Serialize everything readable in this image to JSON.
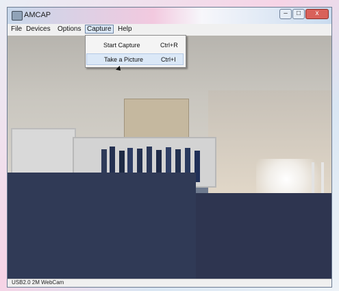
{
  "window": {
    "title": "AMCAP"
  },
  "menubar": {
    "items": [
      {
        "label": "File"
      },
      {
        "label": "Devices"
      },
      {
        "label": "Options"
      },
      {
        "label": "Capture"
      },
      {
        "label": "Help"
      }
    ],
    "active": "Capture"
  },
  "capture_menu": {
    "items": [
      {
        "label": "Start Capture",
        "shortcut": "Ctrl+R"
      },
      {
        "label": "Take a Picture",
        "shortcut": "Ctrl+I",
        "highlighted": true
      }
    ]
  },
  "statusbar": {
    "text": "USB2.0 2M WebCam"
  },
  "colors": {
    "menu_highlight": "#dbe8f7",
    "close_button": "#d9615a"
  },
  "icons": {
    "app": "camera-app-icon",
    "minimize": "minimize-icon",
    "maximize": "maximize-icon",
    "close": "close-icon",
    "cursor": "mouse-pointer-icon"
  }
}
